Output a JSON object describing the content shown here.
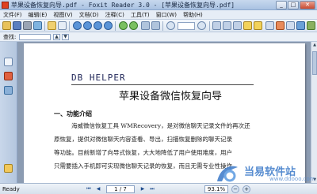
{
  "window": {
    "title": "苹果设备恢复向导.pdf - Foxit Reader 3.0 - [苹果设备恢复向导.pdf]",
    "min": "_",
    "max": "□",
    "close": "✕"
  },
  "menubar": [
    "文件(F)",
    "编辑(E)",
    "视图(V)",
    "文档(D)",
    "注释(C)",
    "工具(T)",
    "窗口(W)",
    "帮助(H)"
  ],
  "findbar": {
    "label": "查找:"
  },
  "document": {
    "logo": "DB HELPER",
    "title": "苹果设备微信恢复向导",
    "section": "一、功能介绍",
    "lines": [
      "海威微信恢复工具 WMRecovery，是对微信聊天记录文件的再次还",
      "原恢复，提供对微信聊天内容查看、导出，扫描恢复删除的聊天记录",
      "等功能。目前新增了向导式恢复，大大地降低了用户使用难度，用户",
      "只需要插入手机即可实现微信聊天记录的恢复，而且无需专业性操作"
    ]
  },
  "watermark": {
    "text": "当易软件站",
    "url": "www.ddooo.com"
  },
  "statusbar": {
    "status": "Ready",
    "page": "1 / 7",
    "zoom": "93.1%",
    "zoom_out": "−",
    "zoom_in": "+"
  },
  "icons": {
    "first": "⏮",
    "prev": "◀",
    "next": "▶",
    "last": "⏭",
    "up": "▲",
    "down": "▼"
  }
}
